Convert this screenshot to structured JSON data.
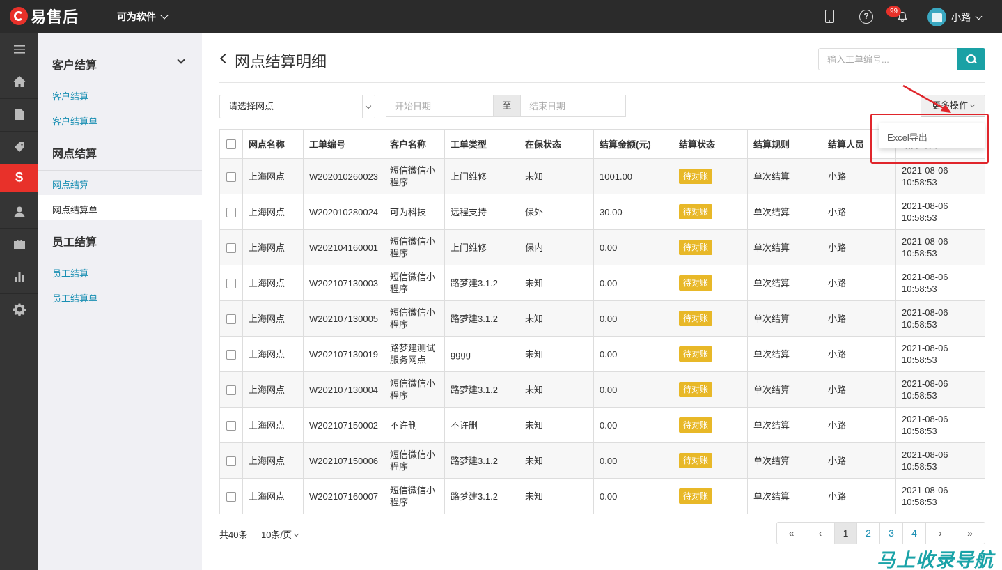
{
  "header": {
    "logo_text": "易售后",
    "company": "可为软件",
    "notification_count": "99",
    "user_name": "小路"
  },
  "side_menu": {
    "groups": [
      {
        "title": "客户结算",
        "items": [
          "客户结算",
          "客户结算单"
        ]
      },
      {
        "title": "网点结算",
        "items": [
          "网点结算",
          "网点结算单"
        ]
      },
      {
        "title": "员工结算",
        "items": [
          "员工结算",
          "员工结算单"
        ]
      }
    ]
  },
  "page": {
    "title": "网点结算明细",
    "search_placeholder": "输入工单编号..."
  },
  "filters": {
    "site_select": "请选择网点",
    "start_date_placeholder": "开始日期",
    "date_separator": "至",
    "end_date_placeholder": "结束日期",
    "more_actions": "更多操作",
    "dropdown_item": "Excel导出"
  },
  "table": {
    "columns": [
      "网点名称",
      "工单编号",
      "客户名称",
      "工单类型",
      "在保状态",
      "结算金额(元)",
      "结算状态",
      "结算规则",
      "结算人员",
      "结算时间"
    ],
    "rows": [
      [
        "上海网点",
        "W202010260023",
        "短信微信小程序",
        "上门维修",
        "未知",
        "1001.00",
        "待对账",
        "单次结算",
        "小路",
        "2021-08-06 10:58:53"
      ],
      [
        "上海网点",
        "W202010280024",
        "可为科技",
        "远程支持",
        "保外",
        "30.00",
        "待对账",
        "单次结算",
        "小路",
        "2021-08-06 10:58:53"
      ],
      [
        "上海网点",
        "W202104160001",
        "短信微信小程序",
        "上门维修",
        "保内",
        "0.00",
        "待对账",
        "单次结算",
        "小路",
        "2021-08-06 10:58:53"
      ],
      [
        "上海网点",
        "W202107130003",
        "短信微信小程序",
        "路梦建3.1.2",
        "未知",
        "0.00",
        "待对账",
        "单次结算",
        "小路",
        "2021-08-06 10:58:53"
      ],
      [
        "上海网点",
        "W202107130005",
        "短信微信小程序",
        "路梦建3.1.2",
        "未知",
        "0.00",
        "待对账",
        "单次结算",
        "小路",
        "2021-08-06 10:58:53"
      ],
      [
        "上海网点",
        "W202107130019",
        "路梦建测试服务网点",
        "gggg",
        "未知",
        "0.00",
        "待对账",
        "单次结算",
        "小路",
        "2021-08-06 10:58:53"
      ],
      [
        "上海网点",
        "W202107130004",
        "短信微信小程序",
        "路梦建3.1.2",
        "未知",
        "0.00",
        "待对账",
        "单次结算",
        "小路",
        "2021-08-06 10:58:53"
      ],
      [
        "上海网点",
        "W202107150002",
        "不许删",
        "不许删",
        "未知",
        "0.00",
        "待对账",
        "单次结算",
        "小路",
        "2021-08-06 10:58:53"
      ],
      [
        "上海网点",
        "W202107150006",
        "短信微信小程序",
        "路梦建3.1.2",
        "未知",
        "0.00",
        "待对账",
        "单次结算",
        "小路",
        "2021-08-06 10:58:53"
      ],
      [
        "上海网点",
        "W202107160007",
        "短信微信小程序",
        "路梦建3.1.2",
        "未知",
        "0.00",
        "待对账",
        "单次结算",
        "小路",
        "2021-08-06 10:58:53"
      ]
    ]
  },
  "footer": {
    "total": "共40条",
    "page_size": "10条/页",
    "pager": [
      "«",
      "‹",
      "1",
      "2",
      "3",
      "4",
      "›",
      "»"
    ],
    "current_page": "1"
  },
  "watermark": "马上收录导航",
  "colors": {
    "accent": "#1aa1a5",
    "brand_red": "#e8312a",
    "tag_yellow": "#e8b828",
    "link": "#1a8fb3"
  }
}
